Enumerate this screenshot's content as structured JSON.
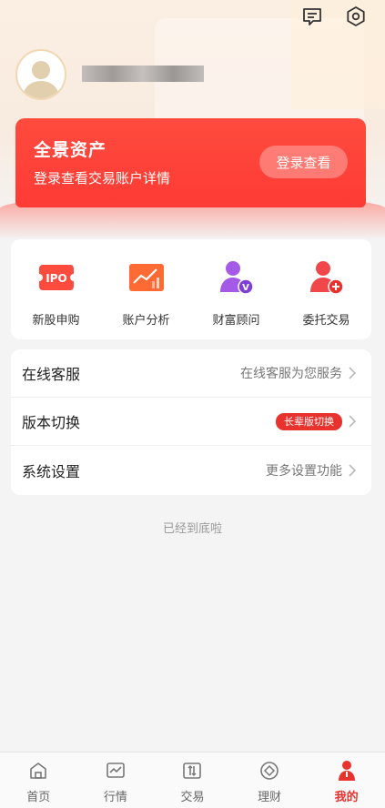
{
  "header": {
    "icons": [
      "message-icon",
      "settings-hex-icon"
    ]
  },
  "profile": {
    "avatar": "avatar",
    "name_masked": true
  },
  "asset_card": {
    "title": "全景资产",
    "subtitle": "登录查看交易账户详情",
    "login_button": "登录查看"
  },
  "quick_actions": [
    {
      "label": "新股申购",
      "icon": "ipo-icon",
      "icon_text": "IPO"
    },
    {
      "label": "账户分析",
      "icon": "analysis-chart-icon"
    },
    {
      "label": "财富顾问",
      "icon": "wealth-advisor-icon",
      "icon_text": "V"
    },
    {
      "label": "委托交易",
      "icon": "entrust-trade-icon"
    }
  ],
  "menu": [
    {
      "label": "在线客服",
      "desc": "在线客服为您服务"
    },
    {
      "label": "版本切换",
      "badge": "长辈版切换"
    },
    {
      "label": "系统设置",
      "desc": "更多设置功能"
    }
  ],
  "footer_note": "已经到底啦",
  "tabbar": [
    {
      "label": "首页",
      "icon": "home-icon"
    },
    {
      "label": "行情",
      "icon": "market-icon"
    },
    {
      "label": "交易",
      "icon": "trade-icon"
    },
    {
      "label": "理财",
      "icon": "finance-icon"
    },
    {
      "label": "我的",
      "icon": "profile-icon",
      "active": true
    }
  ],
  "colors": {
    "accent": "#e8322e",
    "card": "#fd3f38",
    "bg": "#f4f4f4"
  }
}
